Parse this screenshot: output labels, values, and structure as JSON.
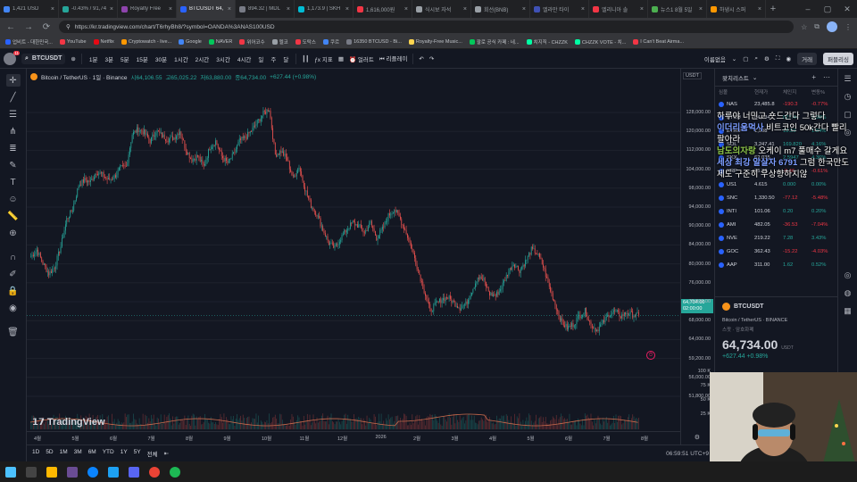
{
  "browser": {
    "tabs": [
      {
        "title": "1,421 USD",
        "color": "#4285f4",
        "active": false
      },
      {
        "title": "-0.43% / 91,74",
        "color": "#26a69a",
        "active": false
      },
      {
        "title": "Royalty Free",
        "color": "#8e44ad",
        "active": false
      },
      {
        "title": "BTCUSDT 64,",
        "color": "#2962ff",
        "active": true
      },
      {
        "title": "894.32 | MDL",
        "color": "#787b86",
        "active": false
      },
      {
        "title": "1,173.9 | SKH",
        "color": "#00bcd4",
        "active": false
      },
      {
        "title": "1,616,000원",
        "color": "#f23645",
        "active": false
      },
      {
        "title": "식시보 자석",
        "color": "#9aa0a6",
        "active": false
      },
      {
        "title": "회선(BNB)",
        "color": "#9aa0a6",
        "active": false
      },
      {
        "title": "엘라만 타이",
        "color": "#3f51b5",
        "active": false
      },
      {
        "title": "엘리니아 솔",
        "color": "#f23645",
        "active": false
      },
      {
        "title": "뉴스1 8월 5일",
        "color": "#4caf50",
        "active": false
      },
      {
        "title": "하냉시 스퍼",
        "color": "#ff9800",
        "active": false
      }
    ],
    "url": "https://kr.tradingview.com/chart/T6rhyBh8/?symbol=OANDA%3ANAS100USD",
    "bookmarks": [
      {
        "label": "업비트 - 대한민국...",
        "color": "#2962ff"
      },
      {
        "label": "YouTube",
        "color": "#f23645"
      },
      {
        "label": "Netflix",
        "color": "#e50914"
      },
      {
        "label": "Cryptowatch - live...",
        "color": "#ff9800"
      },
      {
        "label": "Google",
        "color": "#4285f4"
      },
      {
        "label": "NAVER",
        "color": "#03c75a"
      },
      {
        "label": "위어코수",
        "color": "#f23645"
      },
      {
        "label": "멜코",
        "color": "#9aa0a6"
      },
      {
        "label": "도탁스",
        "color": "#f23645"
      },
      {
        "label": "쿠르",
        "color": "#4285f4"
      },
      {
        "label": "16350 BTCUSD - Bi...",
        "color": "#787b86"
      },
      {
        "label": "Royalty-Free Music...",
        "color": "#ffd54f"
      },
      {
        "label": "팔로 공식 카페 : 네...",
        "color": "#03c75a"
      },
      {
        "label": "치지직 - CHZZK",
        "color": "#00ffa3"
      },
      {
        "label": "CHZZK VOTE - 치...",
        "color": "#00ffa3"
      },
      {
        "label": "I Can't Beat Airma...",
        "color": "#f23645"
      }
    ]
  },
  "toolbar": {
    "symbol": "BTCUSDT",
    "notifications": "11",
    "timeframes": [
      "1분",
      "3분",
      "5분",
      "15분",
      "30분",
      "1시간",
      "2시간",
      "3시간",
      "4시간",
      "일",
      "주",
      "달"
    ],
    "indicators": "지표",
    "alerts": "얼러트",
    "replay": "리플레이",
    "unnamed": "이름없음",
    "trade": "거래",
    "publish": "퍼블리싱"
  },
  "legend": {
    "name": "Bitcoin / TetherUS · 1일 · Binance",
    "open": "시64,106.55",
    "high": "고65,025.22",
    "low": "저63,880.00",
    "close": "종64,734.00",
    "change": "+627.44 (+0.98%)"
  },
  "price_axis": {
    "currency": "USDT",
    "labels": [
      "128,000.00",
      "120,000.00",
      "112,000.00",
      "104,000.00",
      "98,000.00",
      "94,000.00",
      "90,000.00",
      "84,000.00",
      "80,000.00",
      "76,000.00",
      "72,000.00",
      "68,000.00",
      "64,000.00",
      "59,200.00",
      "56,000.00",
      "51,800.00",
      "100 K",
      "75 K",
      "50 K",
      "25 K"
    ],
    "current": "64,734.00",
    "countdown": "02:00:00"
  },
  "time_axis": {
    "labels": [
      "4월",
      "5월",
      "6월",
      "7월",
      "8월",
      "9월",
      "10월",
      "11월",
      "12월",
      "2026",
      "2월",
      "3월",
      "4월",
      "5월",
      "6월",
      "7월",
      "8월"
    ]
  },
  "bottom": {
    "ranges": [
      "1D",
      "5D",
      "1M",
      "3M",
      "6M",
      "YTD",
      "1Y",
      "5Y",
      "전체"
    ],
    "clock": "06:59:51 UTC+9"
  },
  "watermark": "TradingView",
  "watchlist": {
    "title": "왓치리스트",
    "cols": [
      "심볼",
      "현재가",
      "체인지",
      "변동%"
    ],
    "rows": [
      {
        "sym": "NAS",
        "last": "23,485.8",
        "chg": "-190.3",
        "pct": "-0.77%",
        "up": false
      },
      {
        "sym": "BTCU",
        "last": "64,734",
        "chg": "627.44",
        "pct": "0.98%",
        "up": true
      },
      {
        "sym": "ETHU",
        "last": "1,908",
        "chg": "18.59",
        "pct": "1.84%",
        "up": true
      },
      {
        "sym": "SOL",
        "last": "3,247.41",
        "chg": "169.820",
        "pct": "4.16%",
        "up": true
      },
      {
        "sym": "SKX",
        "last": "62.035",
        "chg": "2.5947",
        "pct": "4.36%",
        "up": true
      },
      {
        "sym": "XRP",
        "last": "75.32",
        "chg": "-0.46",
        "pct": "-0.61%",
        "up": false
      },
      {
        "sym": "US1",
        "last": "4.615",
        "chg": "0.000",
        "pct": "0.00%",
        "up": true
      },
      {
        "sym": "SNC",
        "last": "1,330.50",
        "chg": "-77.12",
        "pct": "-5.48%",
        "up": false
      },
      {
        "sym": "INTI",
        "last": "101.06",
        "chg": "0.20",
        "pct": "0.20%",
        "up": true
      },
      {
        "sym": "AMI",
        "last": "482.05",
        "chg": "-36.53",
        "pct": "-7.04%",
        "up": false
      },
      {
        "sym": "NVE",
        "last": "219.22",
        "chg": "7.28",
        "pct": "3.43%",
        "up": true
      },
      {
        "sym": "GOC",
        "last": "362.43",
        "chg": "-15.22",
        "pct": "-4.03%",
        "up": false
      },
      {
        "sym": "AAP",
        "last": "311.00",
        "chg": "1.62",
        "pct": "0.52%",
        "up": true
      }
    ]
  },
  "details": {
    "symbol": "BTCUSDT",
    "name": "Bitcoin / TetherUS · BINANCE",
    "sub": "스팟 · 암호화폐",
    "price": "64,734.00",
    "currency": "USDT",
    "change": "+627.44 +0.98%"
  },
  "chat": [
    {
      "nick": "",
      "text": "하루야 너민고 숏드간다 그렇다",
      "color": "#ffffff"
    },
    {
      "nick": "이더리움먹사",
      "text": "비트코인 50k간다 빨리 팔아라",
      "color": "#7b9cff"
    },
    {
      "nick": "남도의자랑",
      "text": "오케이 m7 풀매수 갈게요",
      "color": "#8bc34a"
    },
    {
      "nick": "세상 최강 알살자 6791",
      "text": "그럼 한국만도 제도 구준히 우상향하지않",
      "color": "#7b9cff"
    }
  ],
  "chart_data": {
    "type": "candlestick",
    "symbol": "BTCUSDT",
    "interval": "1D",
    "ylim": [
      48000,
      132000
    ],
    "close_path": [
      82000,
      84000,
      80000,
      77000,
      79000,
      85000,
      93000,
      96000,
      103000,
      104500,
      104000,
      107000,
      106000,
      104500,
      105500,
      108000,
      108500,
      118000,
      119500,
      118500,
      116000,
      119000,
      117500,
      116500,
      117000,
      119000,
      113500,
      110500,
      111500,
      108500,
      114000,
      116000,
      111500,
      109500,
      112000,
      116000,
      117000,
      119000,
      121500,
      124000,
      125500,
      112000,
      113000,
      110500,
      105000,
      108500,
      102000,
      97000,
      94500,
      90000,
      86000,
      84500,
      87500,
      90000,
      92000,
      91000,
      89000,
      92000,
      87500,
      90000,
      94000,
      96000,
      93000,
      89000,
      84000,
      78000,
      72000,
      66000,
      68000,
      69500,
      70000,
      68500,
      67000,
      68000,
      72000,
      76000,
      75000,
      71000,
      70500,
      73000,
      77000,
      80000,
      78000,
      80500,
      84000,
      83000,
      79000,
      73000,
      68000,
      63000,
      61000,
      62000,
      64500,
      66000,
      62000,
      60500,
      62500,
      65000,
      66000,
      64500,
      65500,
      65000,
      64734
    ],
    "current": 64734,
    "change": 627.44,
    "change_pct": 0.98
  }
}
